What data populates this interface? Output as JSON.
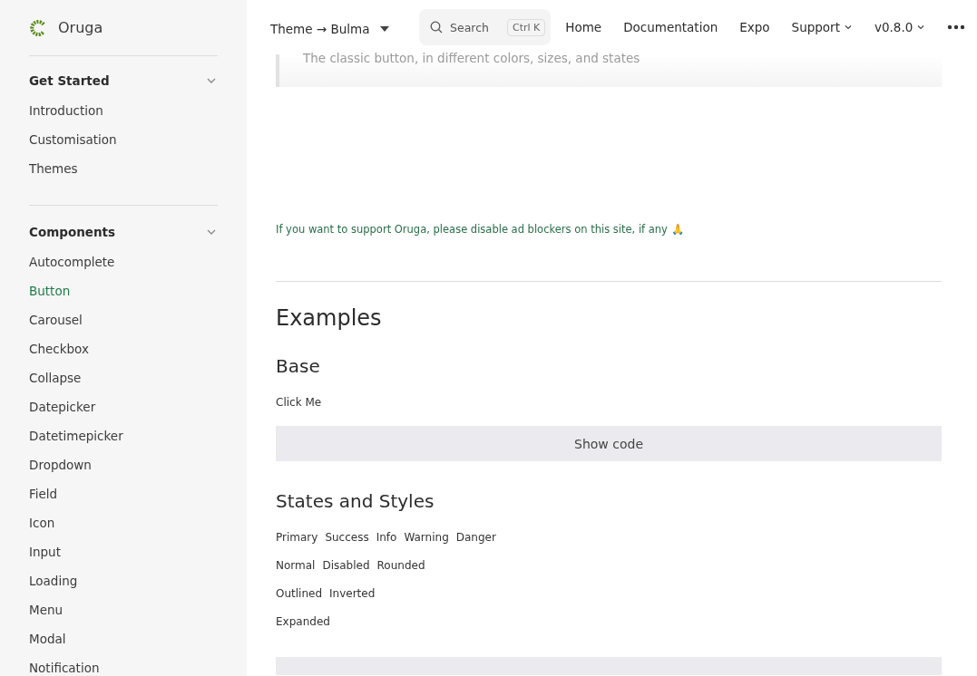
{
  "logo": {
    "name": "Oruga"
  },
  "sidebar": {
    "sections": [
      {
        "title": "Get Started",
        "expanded": true,
        "items": [
          {
            "label": "Introduction",
            "selected": false
          },
          {
            "label": "Customisation",
            "selected": false
          },
          {
            "label": "Themes",
            "selected": false
          }
        ]
      },
      {
        "title": "Components",
        "expanded": true,
        "items": [
          {
            "label": "Autocomplete",
            "selected": false
          },
          {
            "label": "Button",
            "selected": true
          },
          {
            "label": "Carousel",
            "selected": false
          },
          {
            "label": "Checkbox",
            "selected": false
          },
          {
            "label": "Collapse",
            "selected": false
          },
          {
            "label": "Datepicker",
            "selected": false
          },
          {
            "label": "Datetimepicker",
            "selected": false
          },
          {
            "label": "Dropdown",
            "selected": false
          },
          {
            "label": "Field",
            "selected": false
          },
          {
            "label": "Icon",
            "selected": false
          },
          {
            "label": "Input",
            "selected": false
          },
          {
            "label": "Loading",
            "selected": false
          },
          {
            "label": "Menu",
            "selected": false
          },
          {
            "label": "Modal",
            "selected": false
          },
          {
            "label": "Notification",
            "selected": false
          }
        ]
      }
    ]
  },
  "header": {
    "theme": "Theme → Bulma",
    "search": {
      "placeholder": "Search",
      "shortcut": "Ctrl K"
    },
    "nav": [
      {
        "label": "Home",
        "kind": "link"
      },
      {
        "label": "Documentation",
        "kind": "link"
      },
      {
        "label": "Expo",
        "kind": "link"
      },
      {
        "label": "Support",
        "kind": "menu"
      },
      {
        "label": "v0.8.0",
        "kind": "menu"
      }
    ]
  },
  "content": {
    "lead": "The classic button, in different colors, sizes, and states",
    "ad_note": "If you want to support Oruga, please disable ad blockers on this site, if any 🙏",
    "heading": "Examples",
    "sections": [
      {
        "title": "Base",
        "rows": [
          [
            "Click Me"
          ]
        ],
        "code_button": "Show code"
      },
      {
        "title": "States and Styles",
        "rows": [
          [
            "Primary",
            "Success",
            "Info",
            "Warning",
            "Danger"
          ],
          [
            "Normal",
            "Disabled",
            "Rounded"
          ],
          [
            "Outlined",
            "Inverted"
          ],
          [
            "Expanded"
          ]
        ]
      }
    ]
  }
}
